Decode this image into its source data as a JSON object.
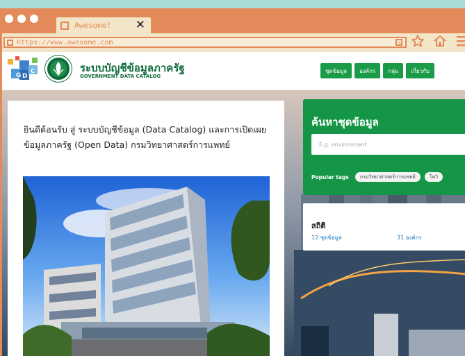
{
  "browser": {
    "tab_title": "Awesome!",
    "close_glyph": "✕",
    "url": "https://www.awesome.com"
  },
  "site": {
    "title": "ระบบบัญชีข้อมูลภาครัฐ",
    "subtitle": "GOVERNMENT DATA CATALOG",
    "nav": [
      "ชุดข้อมูล",
      "องค์กร",
      "กลุ่ม",
      "เกี่ยวกับ"
    ]
  },
  "welcome": {
    "text": "ยินดีต้อนรับ สู่ ระบบบัญชีข้อมูล (Data Catalog) และการเปิดเผยข้อมูลภาครัฐ (Open Data) กรมวิทยาศาสตร์การแพทย์"
  },
  "search": {
    "title": "ค้นหาชุดข้อมูล",
    "placeholder": "E.g. environment",
    "tags_label": "Popular tags",
    "tags": [
      "กรมวิทยาศาสตร์การแพทย์",
      "โควิ"
    ]
  },
  "stats": {
    "title": "สถิติ",
    "datasets": "12 ชุดข้อมูล",
    "organizations": "31 องค์กร"
  },
  "icons": {
    "url_arrow": "arrow-icon",
    "star": "star-icon",
    "home": "home-icon",
    "menu": "menu-icon"
  },
  "colors": {
    "browser_accent": "#e48a5a",
    "site_green": "#149646",
    "link_blue": "#1a7cc4"
  }
}
